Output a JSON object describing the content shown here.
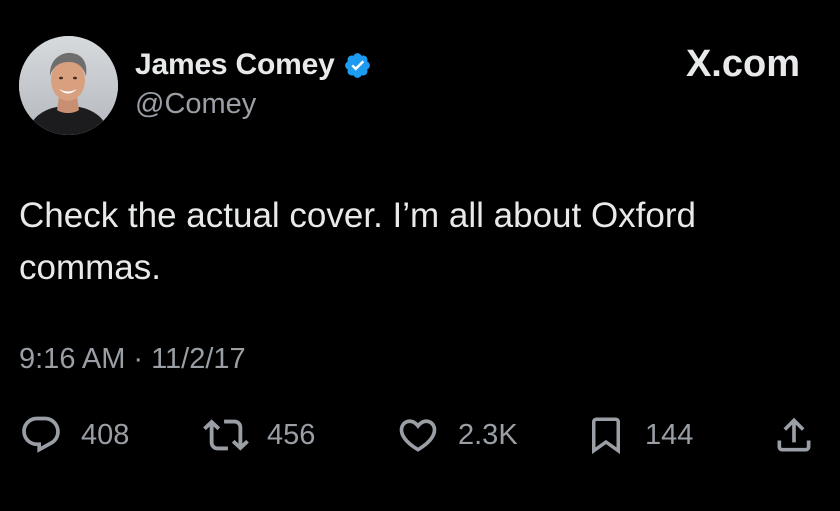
{
  "tweet": {
    "author": {
      "display_name": "James Comey",
      "handle": "@Comey",
      "verified": true,
      "avatar_icon": "profile-photo"
    },
    "brand": "X.com",
    "text": "Check the actual cover. I’m all about Oxford commas.",
    "timestamp": {
      "time": "9:16 AM",
      "separator": "·",
      "date": "11/2/17"
    },
    "metrics": {
      "replies": "408",
      "reposts": "456",
      "likes": "2.3K",
      "bookmarks": "144"
    }
  },
  "icons": {
    "reply": "reply-icon",
    "repost": "repost-icon",
    "like": "heart-icon",
    "bookmark": "bookmark-icon",
    "share": "share-icon",
    "verified": "verified-badge-icon"
  },
  "colors": {
    "background": "#000000",
    "text_primary": "#e7e9ea",
    "text_secondary": "#9a9fa5",
    "verified_blue": "#1d9bf0"
  }
}
